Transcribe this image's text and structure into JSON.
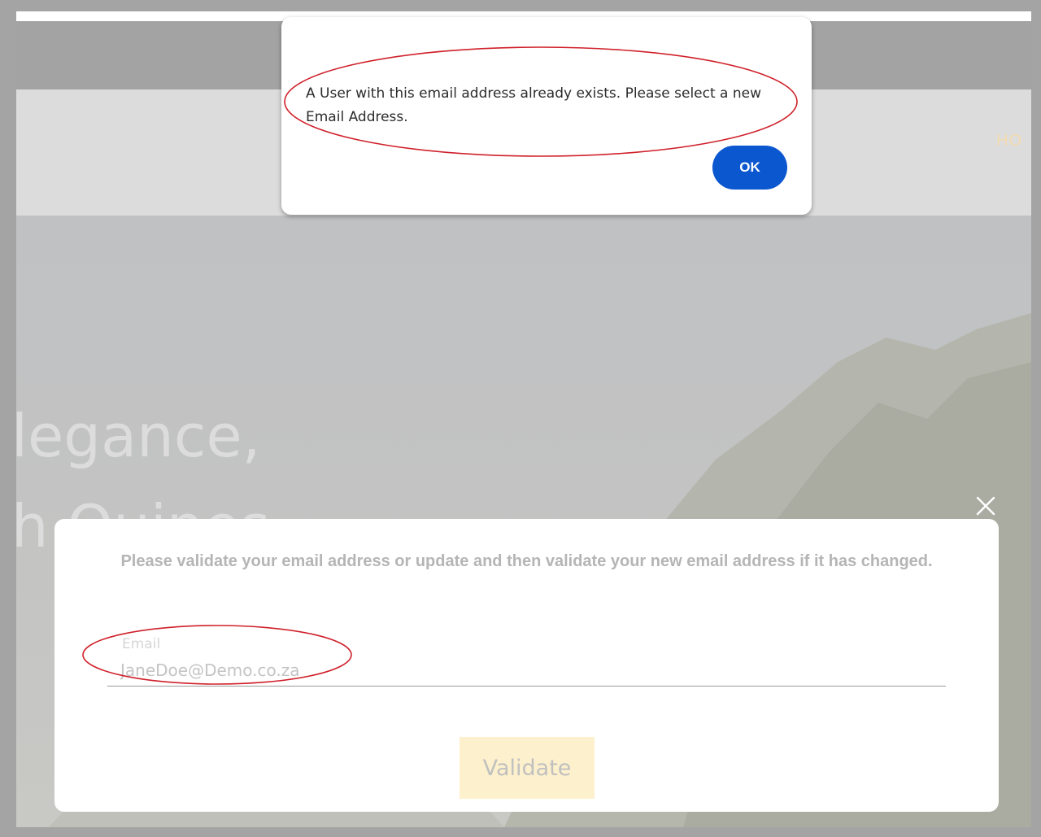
{
  "header": {
    "nav_home": "HO"
  },
  "hero": {
    "line1": "legance,",
    "line2": "h Quines"
  },
  "alert": {
    "message": "A User with this email address already exists. Please select a new Email Address.",
    "ok_label": "OK",
    "ok_color": "#0b57d0"
  },
  "modal": {
    "message": "Please validate your email address or update and then validate your new email address if it has changed.",
    "email_label": "Email",
    "email_value": "JaneDoe@Demo.co.za",
    "validate_label": "Validate",
    "validate_color": "#fdf0cc",
    "close_icon": "close-icon"
  },
  "annotations": {
    "color": "#d0202a"
  }
}
